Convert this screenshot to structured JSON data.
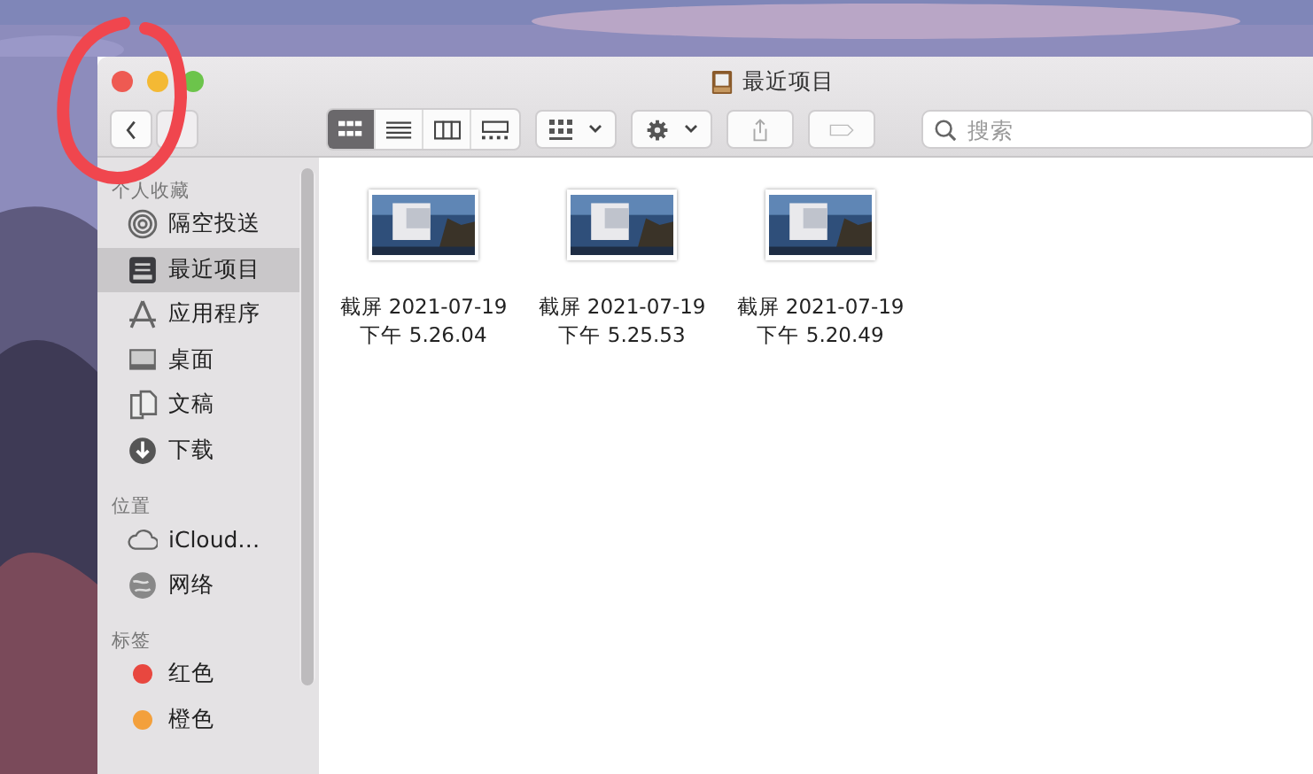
{
  "window": {
    "title": "最近项目"
  },
  "nav": {
    "back": {
      "disabled": false
    },
    "forward": {
      "disabled": true
    }
  },
  "view_modes": [
    {
      "kind": "icons",
      "selected": true
    },
    {
      "kind": "list",
      "selected": false
    },
    {
      "kind": "columns",
      "selected": false
    },
    {
      "kind": "gallery",
      "selected": false
    }
  ],
  "search": {
    "placeholder": "搜索"
  },
  "sidebar": {
    "sections": [
      {
        "title": "个人收藏",
        "items": [
          {
            "label": "隔空投送",
            "kind": "airdrop",
            "selected": false
          },
          {
            "label": "最近项目",
            "kind": "recents",
            "selected": true
          },
          {
            "label": "应用程序",
            "kind": "apps",
            "selected": false
          },
          {
            "label": "桌面",
            "kind": "desktop",
            "selected": false
          },
          {
            "label": "文稿",
            "kind": "documents",
            "selected": false
          },
          {
            "label": "下载",
            "kind": "downloads",
            "selected": false
          }
        ]
      },
      {
        "title": "位置",
        "items": [
          {
            "label": "iCloud…",
            "kind": "icloud",
            "selected": false
          },
          {
            "label": "网络",
            "kind": "network",
            "selected": false
          }
        ]
      },
      {
        "title": "标签",
        "items": [
          {
            "label": "红色",
            "kind": "tag",
            "color": "#e8473f",
            "selected": false
          },
          {
            "label": "橙色",
            "kind": "tag",
            "color": "#f3a03c",
            "selected": false
          }
        ]
      }
    ]
  },
  "files": [
    {
      "name": "截屏 2021-07-19",
      "time": "下午 5.26.04",
      "kind": "picture"
    },
    {
      "name": "截屏 2021-07-19",
      "time": "下午 5.25.53",
      "kind": "picture"
    },
    {
      "name": "截屏 2021-07-19",
      "time": "下午 5.20.49",
      "kind": "picture"
    }
  ]
}
